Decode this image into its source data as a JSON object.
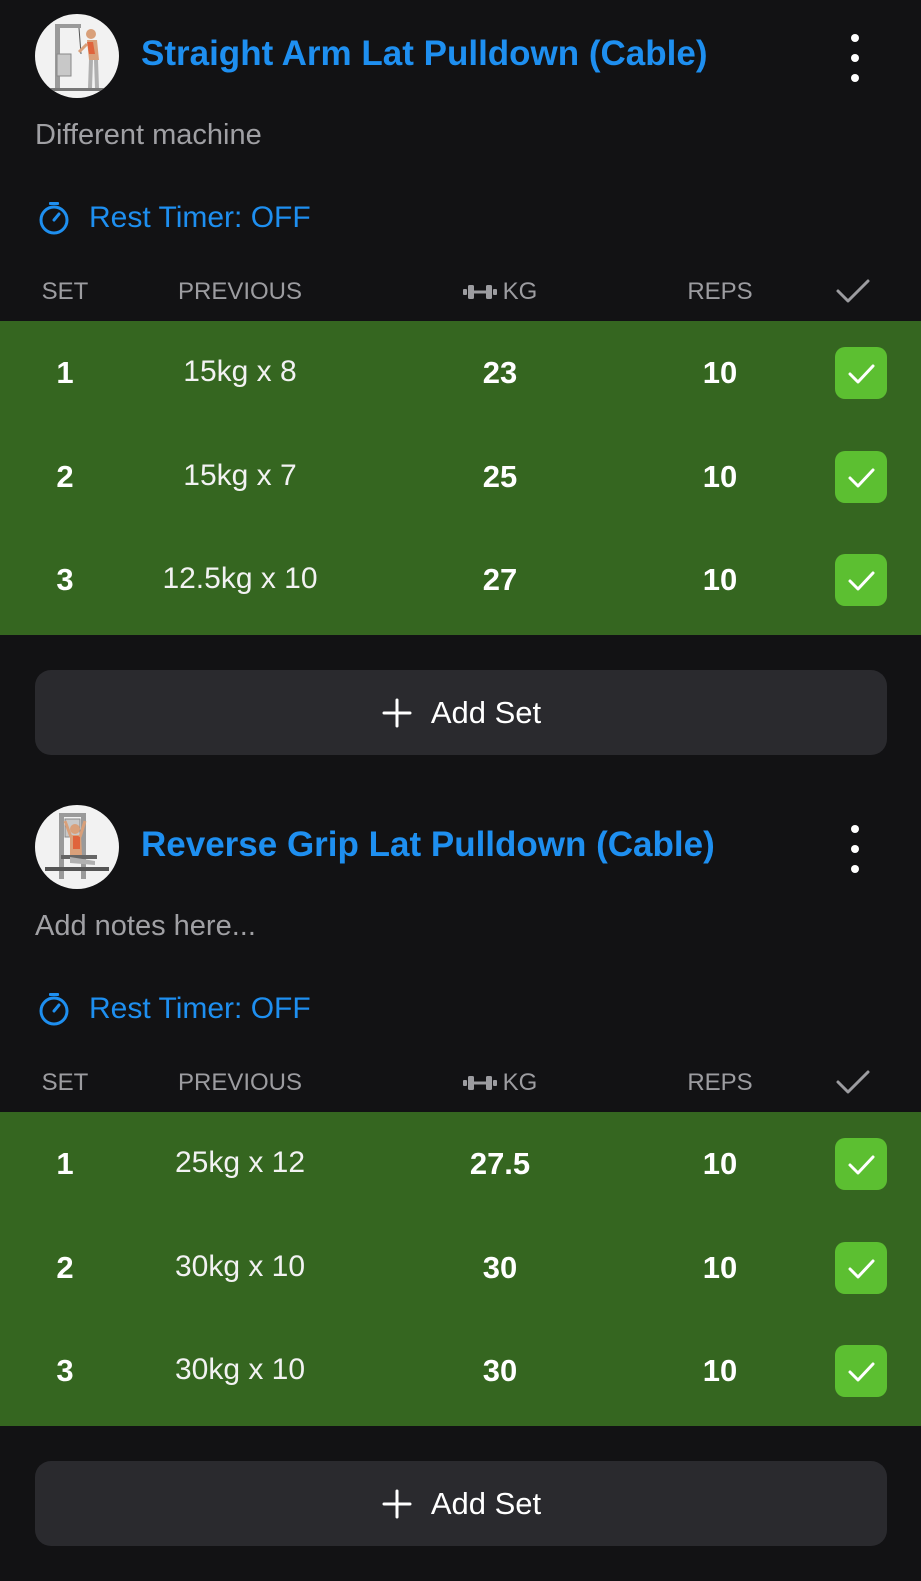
{
  "exercises": [
    {
      "title": "Straight Arm Lat Pulldown (Cable)",
      "notes": "Different machine",
      "rest_timer": "Rest Timer: OFF",
      "columns": {
        "set": "SET",
        "previous": "PREVIOUS",
        "kg": "KG",
        "reps": "REPS"
      },
      "sets": [
        {
          "set": "1",
          "previous": "15kg x 8",
          "kg": "23",
          "reps": "10",
          "completed": true
        },
        {
          "set": "2",
          "previous": "15kg x 7",
          "kg": "25",
          "reps": "10",
          "completed": true
        },
        {
          "set": "3",
          "previous": "12.5kg x 10",
          "kg": "27",
          "reps": "10",
          "completed": true
        }
      ],
      "add_set_label": "Add Set"
    },
    {
      "title": "Reverse Grip Lat Pulldown (Cable)",
      "notes_placeholder": "Add notes here...",
      "rest_timer": "Rest Timer: OFF",
      "columns": {
        "set": "SET",
        "previous": "PREVIOUS",
        "kg": "KG",
        "reps": "REPS"
      },
      "sets": [
        {
          "set": "1",
          "previous": "25kg x 12",
          "kg": "27.5",
          "reps": "10",
          "completed": true
        },
        {
          "set": "2",
          "previous": "30kg x 10",
          "kg": "30",
          "reps": "10",
          "completed": true
        },
        {
          "set": "3",
          "previous": "30kg x 10",
          "kg": "30",
          "reps": "10",
          "completed": true
        }
      ],
      "add_set_label": "Add Set"
    }
  ],
  "icons": {
    "menu": "more-vertical-icon",
    "timer": "stopwatch-icon",
    "weight": "dumbbell-icon",
    "done": "check-icon",
    "add": "plus-icon"
  },
  "colors": {
    "background": "#121214",
    "accent": "#1e8ff0",
    "completed_row": "#356620",
    "completed_check": "#5cbf31",
    "button_bg": "#2a2a2e",
    "muted_text": "#9c9ca0"
  }
}
